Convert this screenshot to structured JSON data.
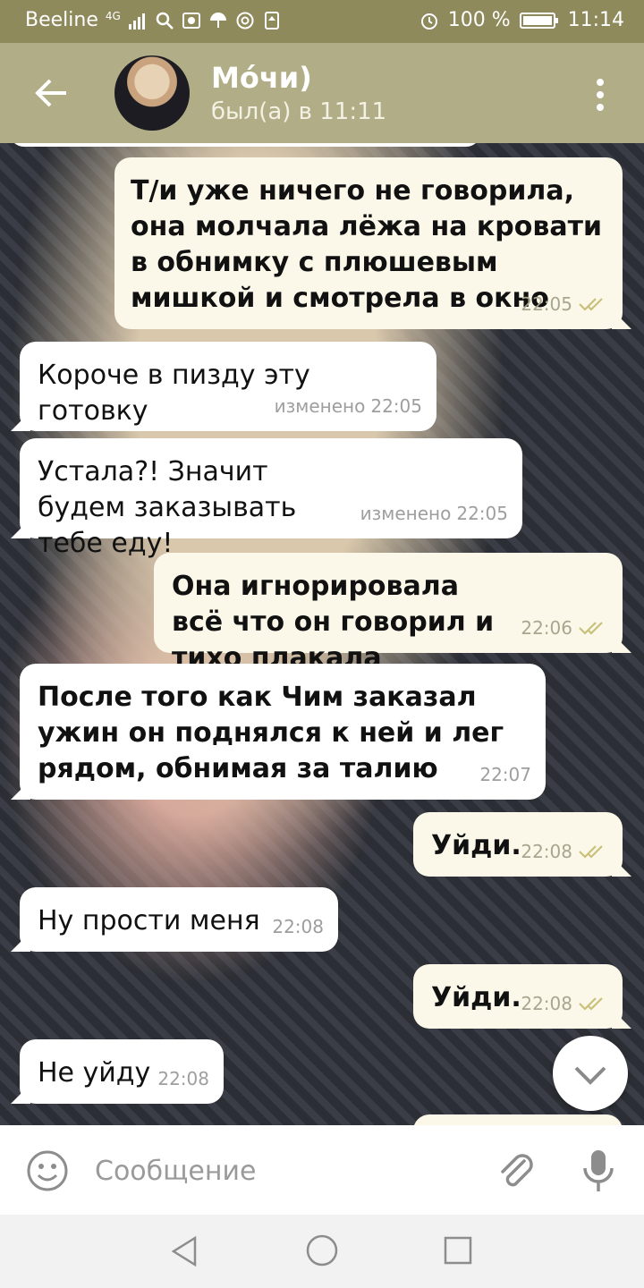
{
  "status_bar": {
    "carrier": "Beeline",
    "network": "4G",
    "battery": "100 %",
    "time": "11:14"
  },
  "header": {
    "name": "Мо́чи)",
    "status": "был(а) в 11:11"
  },
  "messages": [
    {
      "text": "Т/и уже ничего не говорила, она молчала лёжа на кровати в обнимку с плюшевым мишкой и смотрела в окно",
      "time": "22:05",
      "edited": "",
      "direction": "out"
    },
    {
      "text": "Короче в пизду эту готовку",
      "time": "22:05",
      "edited": "изменено",
      "direction": "in"
    },
    {
      "text": "Устала?! Значит будем заказывать тебе еду!",
      "time": "22:05",
      "edited": "изменено",
      "direction": "in"
    },
    {
      "text": "Она игнорировала всё что он говорил и тихо плакала",
      "time": "22:06",
      "edited": "",
      "direction": "out"
    },
    {
      "text": "После того как Чим заказал ужин он поднялся к ней и лег рядом, обнимая за талию",
      "time": "22:07",
      "edited": "",
      "direction": "in"
    },
    {
      "text": "Уйди.",
      "time": "22:08",
      "edited": "",
      "direction": "out"
    },
    {
      "text": "Ну прости меня",
      "time": "22:08",
      "edited": "",
      "direction": "in"
    },
    {
      "text": "Уйди.",
      "time": "22:08",
      "edited": "",
      "direction": "out"
    },
    {
      "text": "Не уйду",
      "time": "22:08",
      "edited": "",
      "direction": "in"
    }
  ],
  "input": {
    "placeholder": "Сообщение"
  },
  "colors": {
    "header": "#b1ae87",
    "statusbar": "#8e8a5c",
    "bubble_out": "#fbf8e9",
    "bubble_in": "#ffffff",
    "read_check": "#c9c07a"
  },
  "icons": [
    "back-arrow-icon",
    "kebab-menu-icon",
    "emoji-icon",
    "paperclip-icon",
    "microphone-icon",
    "chevron-down-icon",
    "double-check-icon",
    "nav-back-icon",
    "nav-home-icon",
    "nav-recent-icon"
  ]
}
